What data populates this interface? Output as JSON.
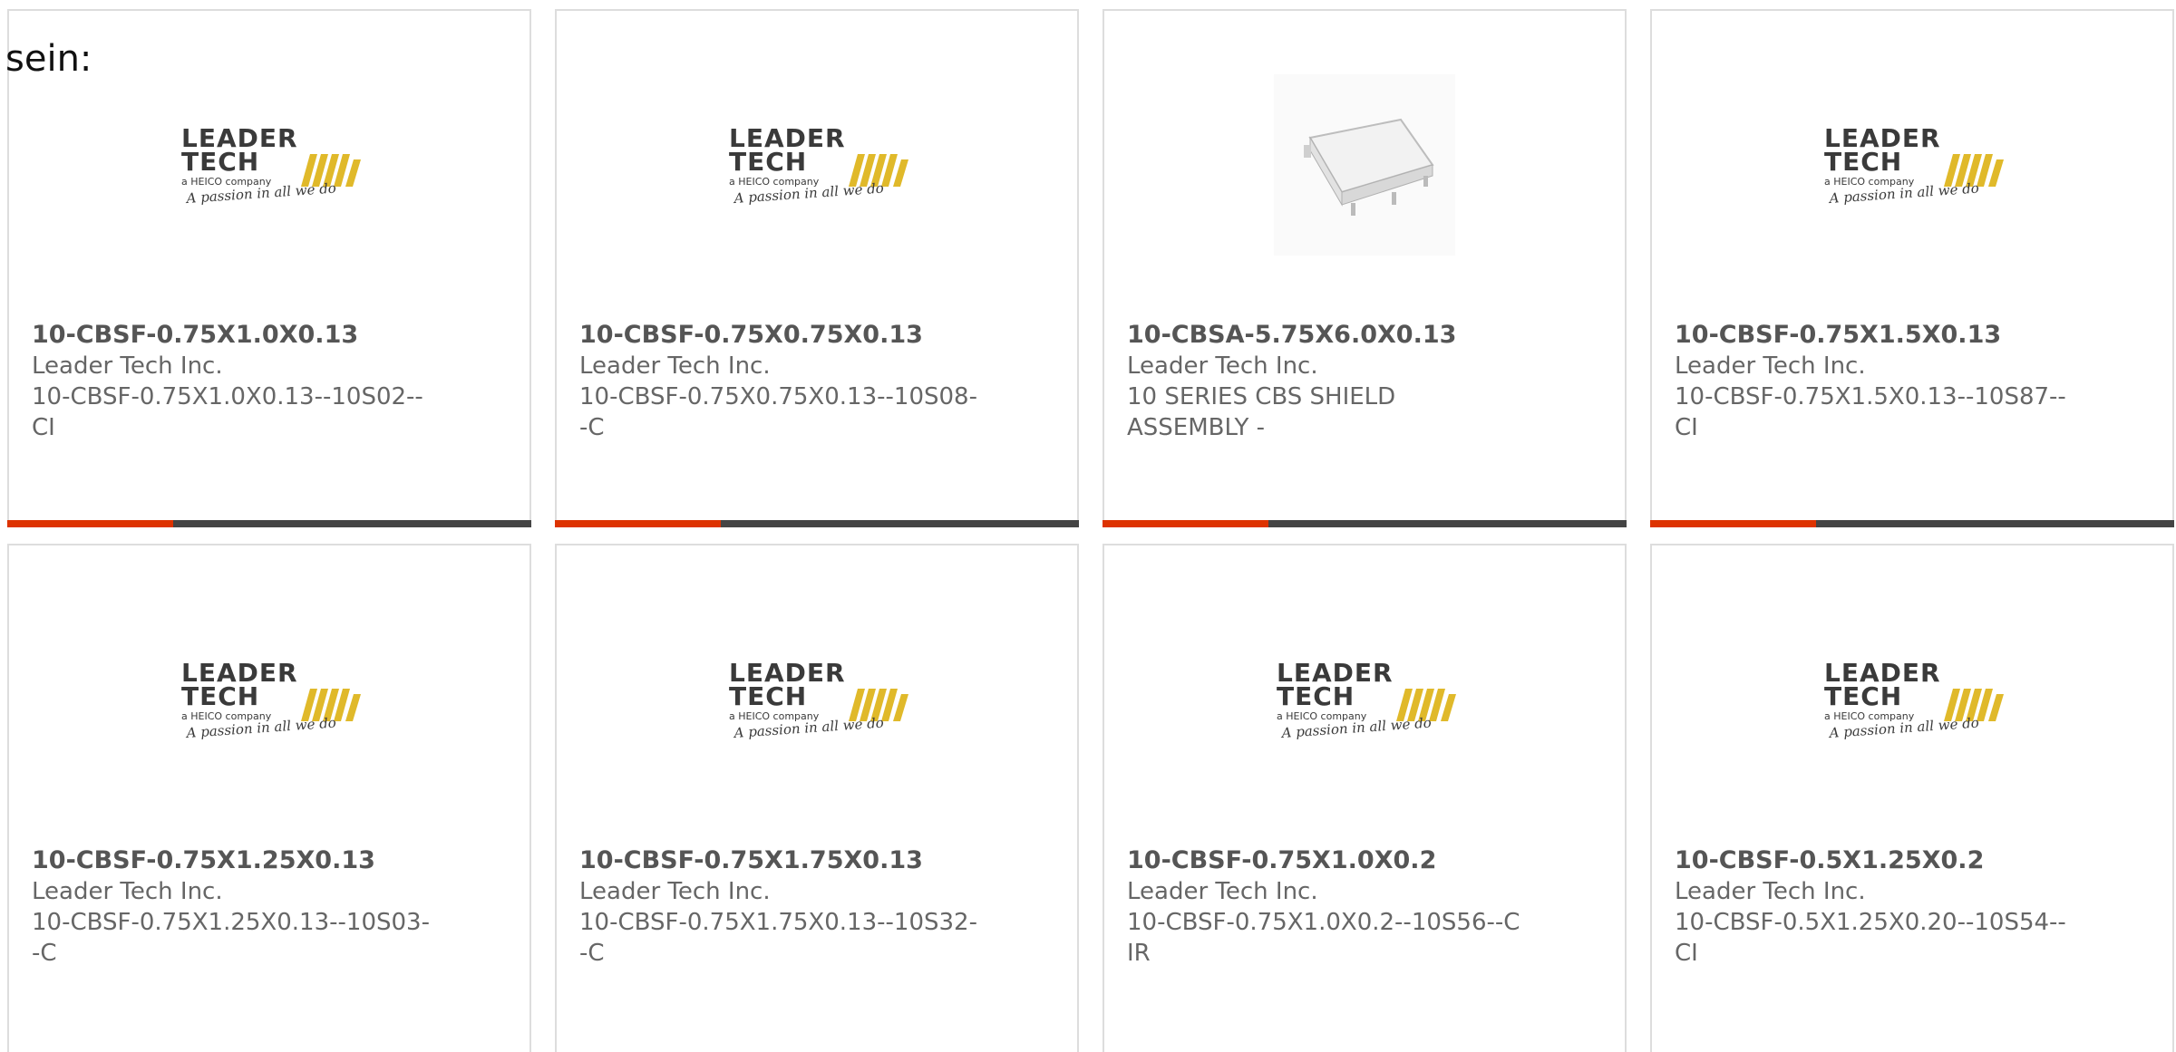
{
  "intro": {
    "text": "sein:"
  },
  "colors": {
    "accent": "#dd3300",
    "bar": "#444444",
    "logo_yellow": "#e0b92a",
    "logo_dark": "#3a3a3a"
  },
  "cards": [
    {
      "part_number": "10-CBSF-0.75X1.0X0.13",
      "manufacturer": "Leader Tech Inc.",
      "description": "10-CBSF-0.75X1.0X0.13--10S02--CI",
      "image": "leader-tech-logo",
      "logo": {
        "line1": "LEADER",
        "line2": "TECH",
        "line3": "a HEICO company",
        "line4": "A passion in all we do"
      }
    },
    {
      "part_number": "10-CBSF-0.75X0.75X0.13",
      "manufacturer": "Leader Tech Inc.",
      "description": "10-CBSF-0.75X0.75X0.13--10S08--C",
      "image": "leader-tech-logo",
      "logo": {
        "line1": "LEADER",
        "line2": "TECH",
        "line3": "a HEICO company",
        "line4": "A passion in all we do"
      }
    },
    {
      "part_number": "10-CBSA-5.75X6.0X0.13",
      "manufacturer": "Leader Tech Inc.",
      "description": "10 SERIES CBS SHIELD ASSEMBLY -",
      "image": "shield-product-photo"
    },
    {
      "part_number": "10-CBSF-0.75X1.5X0.13",
      "manufacturer": "Leader Tech Inc.",
      "description": "10-CBSF-0.75X1.5X0.13--10S87--CI",
      "image": "leader-tech-logo",
      "logo": {
        "line1": "LEADER",
        "line2": "TECH",
        "line3": "a HEICO company",
        "line4": "A passion in all we do"
      }
    },
    {
      "part_number": "10-CBSF-0.75X1.25X0.13",
      "manufacturer": "Leader Tech Inc.",
      "description": "10-CBSF-0.75X1.25X0.13--10S03--C",
      "image": "leader-tech-logo",
      "logo": {
        "line1": "LEADER",
        "line2": "TECH",
        "line3": "a HEICO company",
        "line4": "A passion in all we do"
      }
    },
    {
      "part_number": "10-CBSF-0.75X1.75X0.13",
      "manufacturer": "Leader Tech Inc.",
      "description": "10-CBSF-0.75X1.75X0.13--10S32--C",
      "image": "leader-tech-logo",
      "logo": {
        "line1": "LEADER",
        "line2": "TECH",
        "line3": "a HEICO company",
        "line4": "A passion in all we do"
      }
    },
    {
      "part_number": "10-CBSF-0.75X1.0X0.2",
      "manufacturer": "Leader Tech Inc.",
      "description": "10-CBSF-0.75X1.0X0.2--10S56--CIR",
      "image": "leader-tech-logo",
      "logo": {
        "line1": "LEADER",
        "line2": "TECH",
        "line3": "a HEICO company",
        "line4": "A passion in all we do"
      }
    },
    {
      "part_number": "10-CBSF-0.5X1.25X0.2",
      "manufacturer": "Leader Tech Inc.",
      "description": "10-CBSF-0.5X1.25X0.20--10S54--CI",
      "image": "leader-tech-logo",
      "logo": {
        "line1": "LEADER",
        "line2": "TECH",
        "line3": "a HEICO company",
        "line4": "A passion in all we do"
      }
    }
  ]
}
